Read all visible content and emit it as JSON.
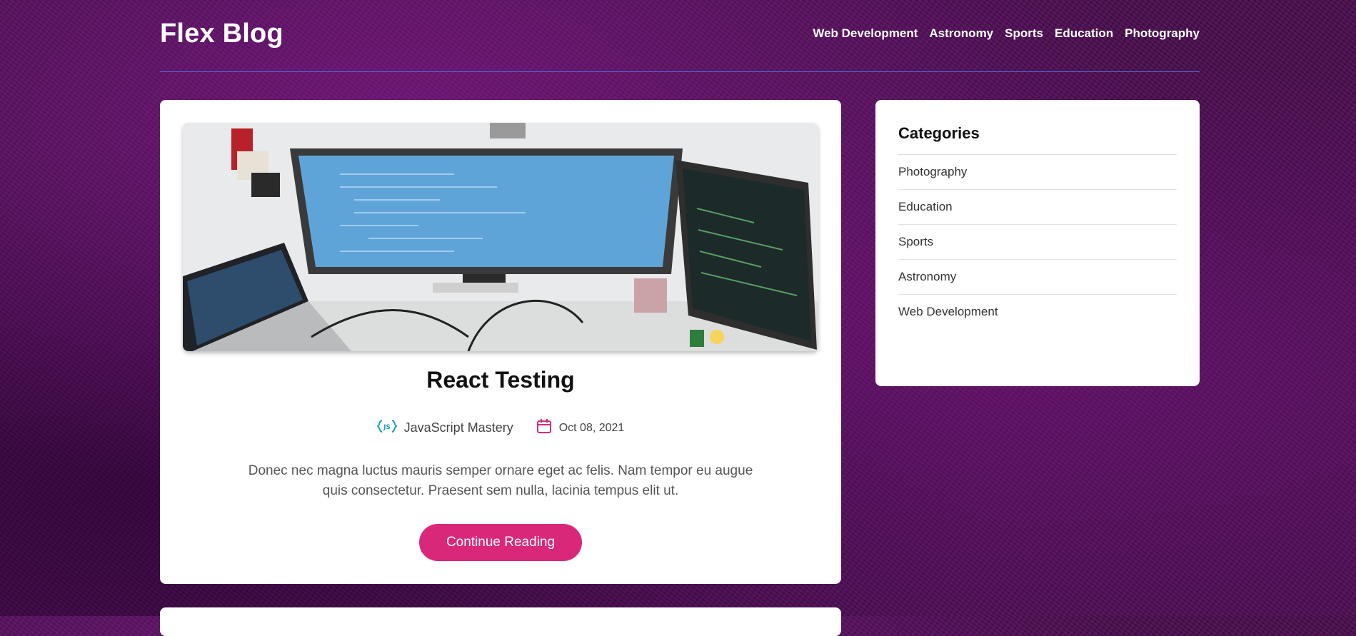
{
  "header": {
    "logo": "Flex Blog",
    "nav": [
      "Web Development",
      "Astronomy",
      "Sports",
      "Education",
      "Photography"
    ]
  },
  "post": {
    "title": "React Testing",
    "author": "JavaScript Mastery",
    "author_icon": "javascript-logo-icon",
    "date": "Oct 08, 2021",
    "date_icon": "calendar-icon",
    "excerpt": "Donec nec magna luctus mauris semper ornare eget ac felis. Nam tempor eu augue quis consectetur. Praesent sem nulla, lacinia tempus elit ut.",
    "button_label": "Continue Reading"
  },
  "sidebar": {
    "title": "Categories",
    "categories": [
      "Photography",
      "Education",
      "Sports",
      "Astronomy",
      "Web Development"
    ]
  },
  "colors": {
    "accent": "#d9287a",
    "header_rule": "#4b6bd6",
    "background": "#4a0f4f",
    "js_icon": "#1ba3b8"
  }
}
